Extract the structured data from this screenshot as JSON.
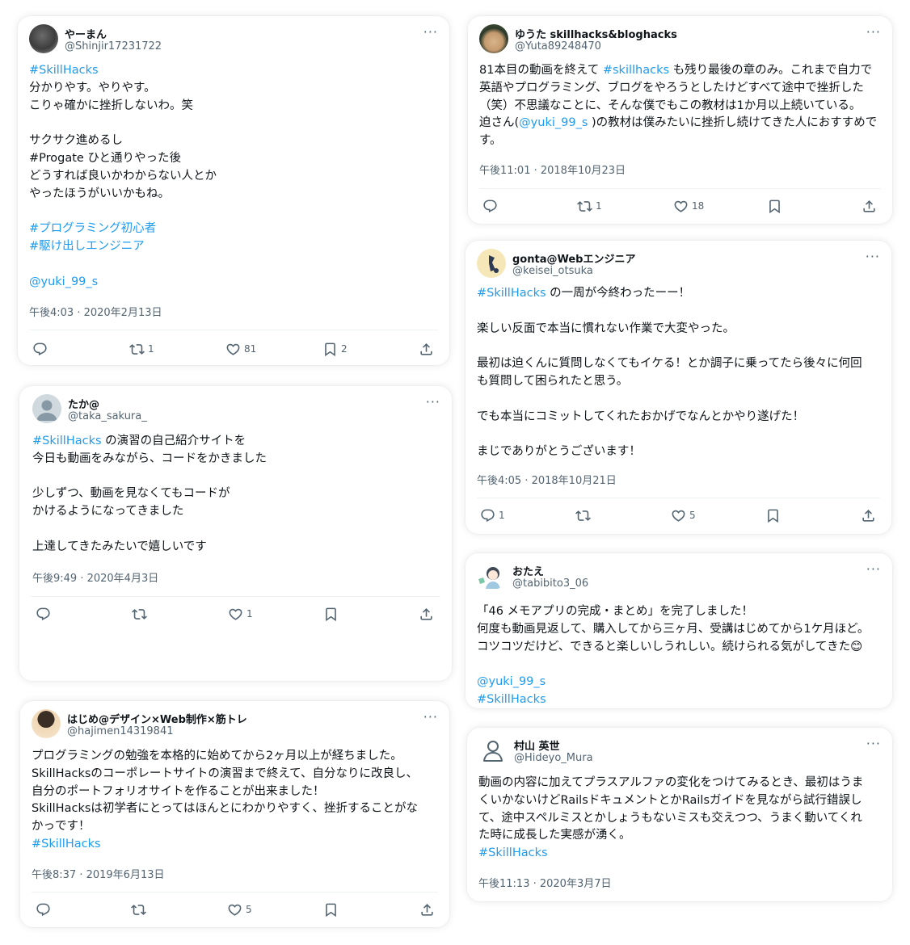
{
  "tweets": [
    {
      "user": "やーまん",
      "handle": "@Shinjir17231722",
      "lines": [
        "#SkillHacks",
        "分かりやす。やりやす。",
        "こりゃ確かに挫折しないわ。笑",
        "",
        "サクサク進めるし",
        "#Progate ひと通りやった後",
        "どうすれば良いかわからない人とか",
        "やったほうがいいかもね。",
        "",
        "#プログラミング初心者",
        "#駆け出しエンジニア",
        "",
        "@yuki_99_s"
      ],
      "time": "午後4:03 · 2020年2月13日",
      "replies": "",
      "retweets": "1",
      "likes": "81",
      "bookmarks": "2"
    },
    {
      "user": "たか@",
      "handle": "@taka_sakura_",
      "lines": [
        "#SkillHacks の演習の自己紹介サイトを",
        "今日も動画をみながら、コードをかきました",
        "",
        "少しずつ、動画を見なくてもコードが",
        "かけるようになってきました",
        "",
        "上達してきたみたいで嬉しいです"
      ],
      "time": "午後9:49 · 2020年4月3日",
      "replies": "",
      "retweets": "",
      "likes": "1",
      "bookmarks": ""
    },
    {
      "user": "はじめ@デザイン×Web制作×筋トレ",
      "handle": "@hajimen14319841",
      "lines": [
        "プログラミングの勉強を本格的に始めてから2ヶ月以上が経ちました。",
        "SkillHacksのコーポレートサイトの演習まで終えて、自分なりに改良し、",
        "自分のポートフォリオサイトを作ることが出来ました！",
        "SkillHacksは初学者にとってはほんとにわかりやすく、挫折することがな",
        "かっです！",
        "#SkillHacks"
      ],
      "time": "午後8:37 · 2019年6月13日",
      "replies": "",
      "retweets": "",
      "likes": "5",
      "bookmarks": ""
    },
    {
      "user": "ゆうた skillhacks&bloghacks",
      "handle": "@Yuta89248470",
      "lines": [
        "81本目の動画を終えて #skillhacks も残り最後の章のみ。これまで自力で",
        "英語やプログラミング、ブログをやろうとしたけどすべて途中で挫折した",
        "（笑）不思議なことに、そんな僕でもこの教材は1か月以上続いている。",
        "迫さん(@yuki_99_s )の教材は僕みたいに挫折し続けてきた人におすすめで",
        "す。"
      ],
      "time": "午後11:01 · 2018年10月23日",
      "replies": "",
      "retweets": "1",
      "likes": "18",
      "bookmarks": ""
    },
    {
      "user": "gonta@Webエンジニア",
      "handle": "@keisei_otsuka",
      "lines": [
        "#SkillHacks の一周が今終わったーー！",
        "",
        "楽しい反面で本当に慣れない作業で大変やった。",
        "",
        "最初は迫くんに質問しなくてもイケる！とか調子に乗ってたら後々に何回",
        "も質問して困られたと思う。",
        "",
        "でも本当にコミットしてくれたおかげでなんとかやり遂げた！",
        "",
        "まじでありがとうございます！"
      ],
      "time": "午後4:05 · 2018年10月21日",
      "replies": "1",
      "retweets": "",
      "likes": "5",
      "bookmarks": ""
    },
    {
      "user": "おたえ",
      "handle": "@tabibito3_06",
      "lines": [
        "「46 メモアプリの完成・まとめ」を完了しました！",
        "何度も動画見返して、購入してから三ヶ月、受講はじめてから1ケ月ほど。",
        "コツコツだけど、できると楽しいしうれしい。続けられる気がしてきた😊",
        "",
        "@yuki_99_s",
        " #SkillHacks"
      ],
      "time": ""
    },
    {
      "user": "村山 英世",
      "handle": "@Hideyo_Mura",
      "lines": [
        "動画の内容に加えてプラスアルファの変化をつけてみるとき、最初はうま",
        "くいかないけどRailsドキュメントとかRailsガイドを見ながら試行錯誤し",
        "て、途中スペルミスとかしょうもないミスも交えつつ、うまく動いてくれ",
        "た時に成長した実感が湧く。",
        "#SkillHacks"
      ],
      "time": "午後11:13 · 2020年3月7日"
    }
  ],
  "ui": {
    "more": "···"
  },
  "colors": {
    "link": "#1d9bf0",
    "muted": "#536471",
    "text": "#0f1419"
  }
}
